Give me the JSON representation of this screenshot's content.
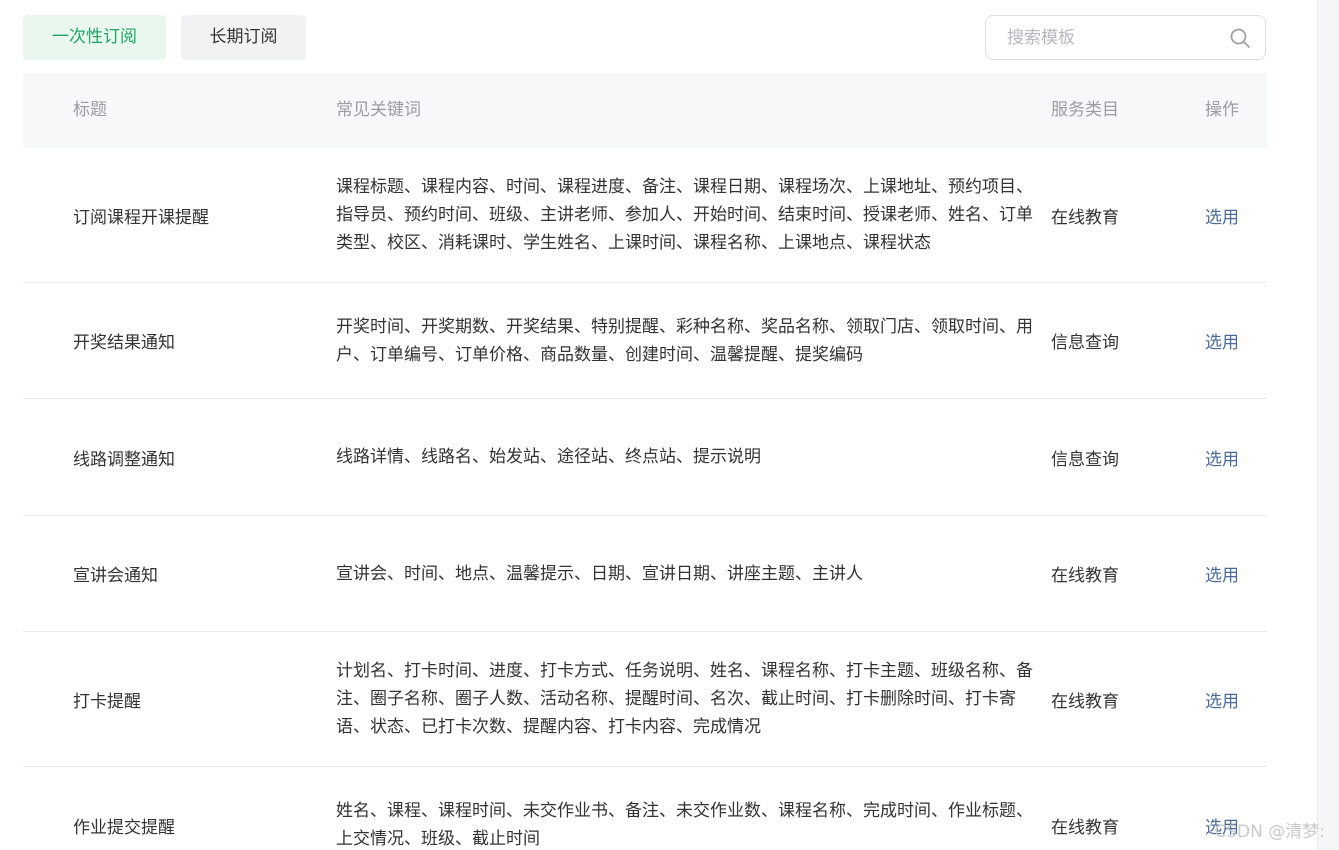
{
  "tabs": [
    {
      "label": "一次性订阅",
      "active": true
    },
    {
      "label": "长期订阅",
      "active": false
    }
  ],
  "search": {
    "placeholder": "搜索模板",
    "value": ""
  },
  "table": {
    "headers": [
      "标题",
      "常见关键词",
      "服务类目",
      "操作"
    ],
    "rows": [
      {
        "title": "订阅课程开课提醒",
        "keywords": "课程标题、课程内容、时间、课程进度、备注、课程日期、课程场次、上课地址、预约项目、指导员、预约时间、班级、主讲老师、参加人、开始时间、结束时间、授课老师、姓名、订单类型、校区、消耗课时、学生姓名、上课时间、课程名称、上课地点、课程状态",
        "category": "在线教育",
        "action": "选用"
      },
      {
        "title": "开奖结果通知",
        "keywords": "开奖时间、开奖期数、开奖结果、特别提醒、彩种名称、奖品名称、领取门店、领取时间、用户、订单编号、订单价格、商品数量、创建时间、温馨提醒、提奖编码",
        "category": "信息查询",
        "action": "选用"
      },
      {
        "title": "线路调整通知",
        "keywords": "线路详情、线路名、始发站、途径站、终点站、提示说明",
        "category": "信息查询",
        "action": "选用"
      },
      {
        "title": "宣讲会通知",
        "keywords": "宣讲会、时间、地点、温馨提示、日期、宣讲日期、讲座主题、主讲人",
        "category": "在线教育",
        "action": "选用"
      },
      {
        "title": "打卡提醒",
        "keywords": "计划名、打卡时间、进度、打卡方式、任务说明、姓名、课程名称、打卡主题、班级名称、备注、圈子名称、圈子人数、活动名称、提醒时间、名次、截止时间、打卡删除时间、打卡寄语、状态、已打卡次数、提醒内容、打卡内容、完成情况",
        "category": "在线教育",
        "action": "选用"
      },
      {
        "title": "作业提交提醒",
        "keywords": "姓名、课程、课程时间、未交作业书、备注、未交作业数、课程名称、完成时间、作业标题、上交情况、班级、截止时间",
        "category": "在线教育",
        "action": "选用"
      }
    ]
  },
  "watermark": "CSDN @清梦:",
  "colors": {
    "accent_green": "#21a665",
    "active_tab_bg": "#e9f7ef",
    "link_blue": "#4a6b9c",
    "header_bg": "#f7f8fa"
  },
  "icons": {
    "search": "search-icon"
  }
}
